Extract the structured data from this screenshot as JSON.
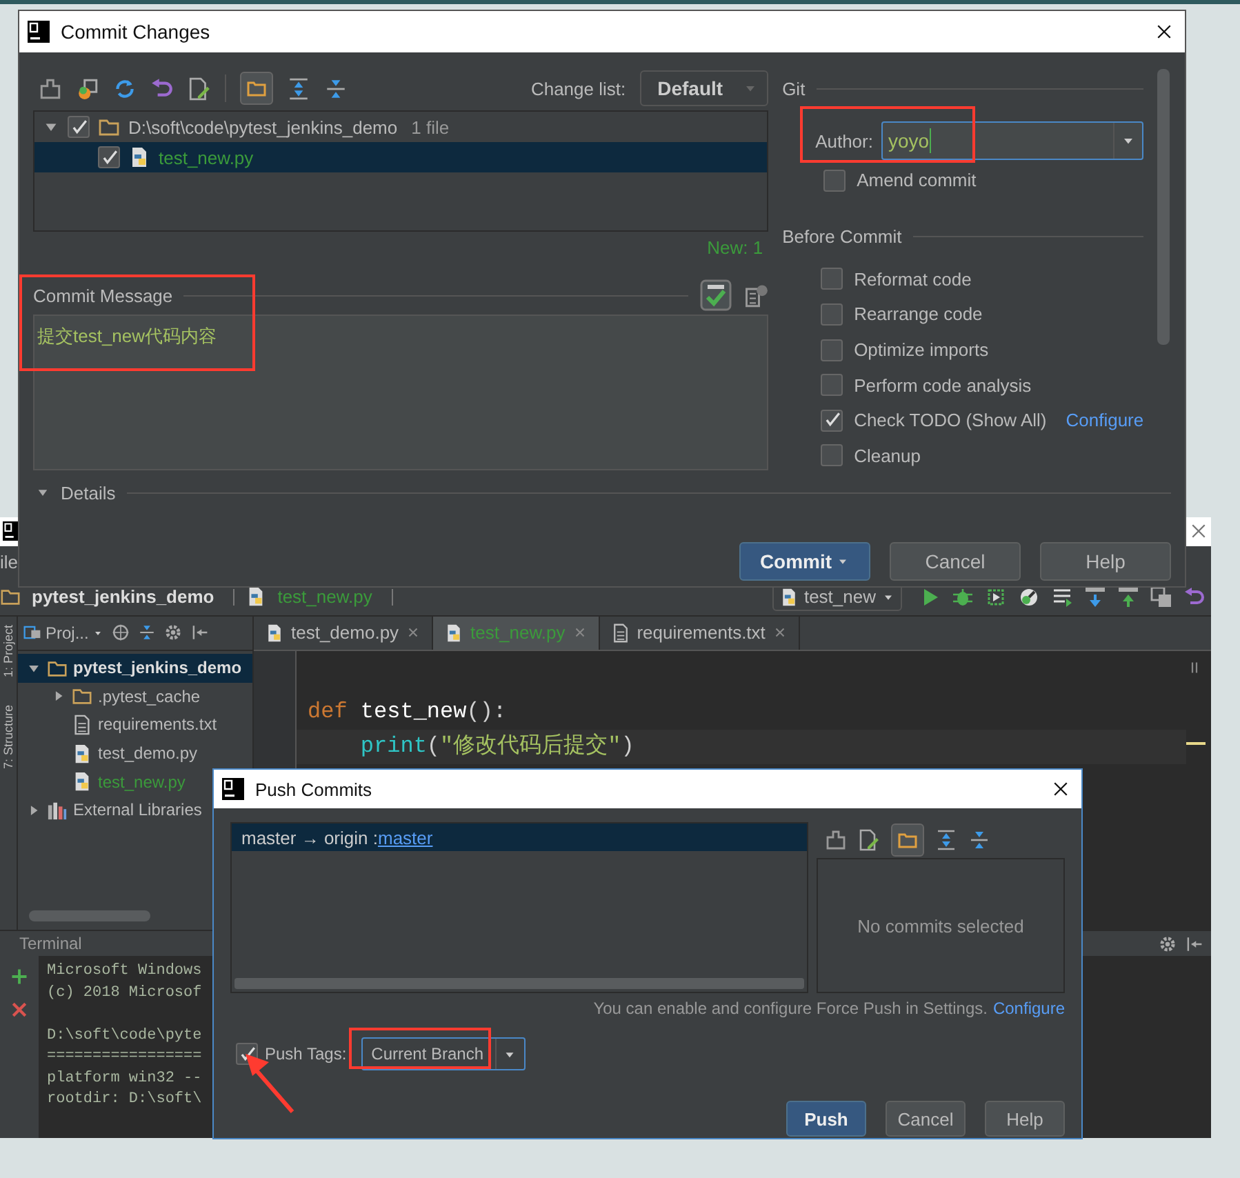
{
  "commit_dialog": {
    "title": "Commit Changes",
    "group_by_folder": true,
    "change_list_label": "Change list:",
    "change_list": "Default",
    "changes": [
      {
        "label": "D:\\soft\\code\\pytest_jenkins_demo",
        "count": "1 file",
        "kind": "folder",
        "checked": true,
        "expanded": true,
        "selected": false,
        "new": false,
        "children": [
          {
            "label": "test_new.py",
            "kind": "python",
            "checked": true,
            "selected": true,
            "new": true
          }
        ]
      }
    ],
    "new_count": "New: 1",
    "message_label": "Commit Message",
    "message": "提交test_new代码内容",
    "details_label": "Details",
    "git_label": "Git",
    "author_label": "Author:",
    "author": "yoyo",
    "amend": {
      "label": "Amend commit",
      "checked": false
    },
    "before_commit_label": "Before Commit",
    "options": [
      {
        "label": "Reformat code",
        "checked": false
      },
      {
        "label": "Rearrange code",
        "checked": false
      },
      {
        "label": "Optimize imports",
        "checked": false
      },
      {
        "label": "Perform code analysis",
        "checked": false
      },
      {
        "label": "Check TODO (Show All)",
        "checked": true,
        "link": "Configure"
      },
      {
        "label": "Cleanup",
        "checked": false
      }
    ],
    "buttons": [
      {
        "label": "Commit",
        "primary": true,
        "menu": true
      },
      {
        "label": "Cancel",
        "primary": false,
        "menu": false
      },
      {
        "label": "Help",
        "primary": false,
        "menu": false
      }
    ]
  },
  "ide": {
    "menu": [
      "ile"
    ],
    "breadcrumbs": [
      {
        "label": "pytest_jenkins_demo",
        "kind": "folder",
        "new": false
      },
      {
        "label": "test_new.py",
        "kind": "python",
        "new": true
      }
    ],
    "run_config": "test_new",
    "side_tabs": [
      "1: Project",
      "7: Structure"
    ],
    "project_view": "Proj...",
    "project_tree": [
      {
        "label": "pytest_jenkins_demo",
        "kind": "folder",
        "expanded": true,
        "selected": true,
        "new": false,
        "children": [
          {
            "label": ".pytest_cache",
            "kind": "folder",
            "expanded": false,
            "selected": false,
            "new": false
          },
          {
            "label": "requirements.txt",
            "kind": "text",
            "selected": false,
            "new": false
          },
          {
            "label": "test_demo.py",
            "kind": "python",
            "selected": false,
            "new": false
          },
          {
            "label": "test_new.py",
            "kind": "python",
            "selected": false,
            "new": true
          }
        ]
      },
      {
        "label": "External Libraries",
        "kind": "library",
        "expanded": false,
        "selected": false,
        "new": false
      }
    ],
    "editor_tabs": [
      {
        "label": "test_demo.py",
        "kind": "python",
        "selected": false,
        "new": false
      },
      {
        "label": "test_new.py",
        "kind": "python",
        "selected": true,
        "new": true
      },
      {
        "label": "requirements.txt",
        "kind": "text",
        "selected": false,
        "new": false
      }
    ],
    "code": [
      [
        {
          "text": "def",
          "kind": "keyword"
        },
        {
          "text": " test_new",
          "kind": "name"
        },
        {
          "text": "():",
          "kind": "plain"
        }
      ],
      [
        {
          "text": "    print",
          "kind": "builtin"
        },
        {
          "text": "(",
          "kind": "plain"
        },
        {
          "text": "\"修改代码后提交\"",
          "kind": "string"
        },
        {
          "text": ")",
          "kind": "plain"
        }
      ]
    ],
    "terminal": {
      "title": "Terminal",
      "blocks": [
        [
          "Microsoft Windows",
          "(c) 2018 Microsof"
        ],
        [
          "D:\\soft\\code\\pyte",
          "=================",
          "platform win32 --",
          "rootdir: D:\\soft\\"
        ]
      ]
    }
  },
  "push_dialog": {
    "title": "Push Commits",
    "group_by_folder": true,
    "branches": [
      {
        "label": "master → origin :",
        "link": "master",
        "selected": true
      }
    ],
    "empty_message": "No commits selected",
    "note": "You can enable and configure Force Push in Settings.",
    "note_link": "Configure",
    "push_tags": {
      "label": "Push Tags:",
      "checked": true,
      "value": "Current Branch"
    },
    "buttons": [
      {
        "label": "Push",
        "primary": true,
        "menu": false
      },
      {
        "label": "Cancel",
        "primary": false,
        "menu": false
      },
      {
        "label": "Help",
        "primary": false,
        "menu": false
      }
    ]
  }
}
